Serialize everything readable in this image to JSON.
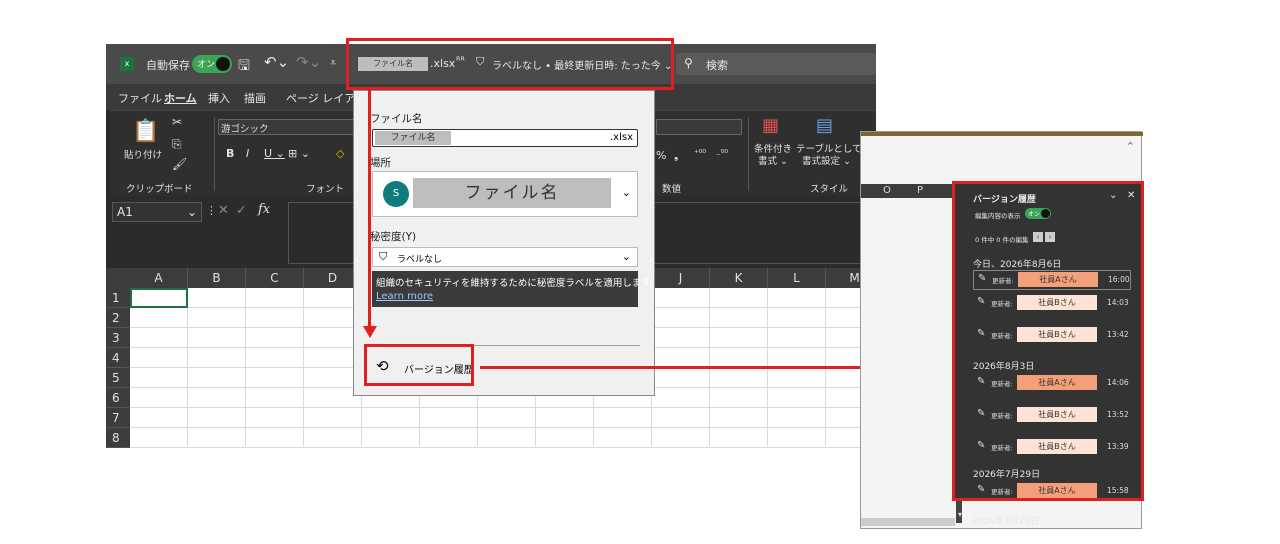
{
  "titlebar": {
    "autosave_label": "自動保存",
    "autosave_toggle": "オン",
    "filename_placeholder": "ファイル名",
    "filename_ext": ".xlsx",
    "file_info": "ラベルなし • 最終更新日時: たった今 ⌄",
    "search_placeholder": "検索"
  },
  "menu": [
    "ファイル",
    "ホーム",
    "挿入",
    "描画",
    "ページ レイアウト"
  ],
  "ribbon": {
    "paste_label": "貼り付け",
    "clipboard_group": "クリップボード",
    "font_name": "游ゴシック",
    "font_group": "フォント",
    "number_group": "数値",
    "cond_format": "条件付き",
    "cond_format2": "書式 ⌄",
    "table_format": "テーブルとして",
    "table_format2": "書式設定 ⌄",
    "style_group": "スタイル"
  },
  "formula_bar": {
    "namebox": "A1",
    "fx": "fx"
  },
  "grid": {
    "columns": [
      "A",
      "B",
      "C",
      "D",
      "",
      "",
      "",
      "",
      "",
      "J",
      "K",
      "L",
      "M"
    ],
    "rows": [
      "1",
      "2",
      "3",
      "4",
      "5",
      "6",
      "7",
      "8"
    ]
  },
  "file_panel": {
    "filename_label": "ファイル名",
    "filename_value": "ファイル名",
    "filename_ext": ".xlsx",
    "location_label": "場所",
    "location_value": "ファイル名",
    "sensitivity_label": "秘密度(Y)",
    "sensitivity_value": "ラベルなし",
    "info_text": "組織のセキュリティを維持するために秘密度ラベルを適用します。",
    "learn_more": "Learn more",
    "version_history": "バージョン履歴"
  },
  "version_window": {
    "col_headers": [
      "O",
      "P"
    ],
    "title": "バージョン履歴",
    "show_changes": "編集内容の表示",
    "toggle": "オン",
    "edits": "0 件中 0 件の編集",
    "groups": [
      {
        "date": "今日、2026年8月6日",
        "entries": [
          {
            "who": "更新者:",
            "name": "社員Aさん",
            "time": "16:00",
            "color": "#f3a07a"
          },
          {
            "who": "更新者:",
            "name": "社員Bさん",
            "time": "14:03",
            "color": "#fde3d5"
          },
          {
            "who": "更新者:",
            "name": "社員Bさん",
            "time": "13:42",
            "color": "#fde3d5"
          }
        ]
      },
      {
        "date": "2026年8月3日",
        "entries": [
          {
            "who": "更新者:",
            "name": "社員Aさん",
            "time": "14:06",
            "color": "#f3a07a"
          },
          {
            "who": "更新者:",
            "name": "社員Bさん",
            "time": "13:52",
            "color": "#fde3d5"
          },
          {
            "who": "更新者:",
            "name": "社員Bさん",
            "time": "13:39",
            "color": "#fde3d5"
          }
        ]
      },
      {
        "date": "2026年7月29日",
        "entries": [
          {
            "who": "更新者:",
            "name": "社員Aさん",
            "time": "15:58",
            "color": "#f3a07a"
          }
        ]
      }
    ],
    "last_date": "2026年7月28日"
  }
}
